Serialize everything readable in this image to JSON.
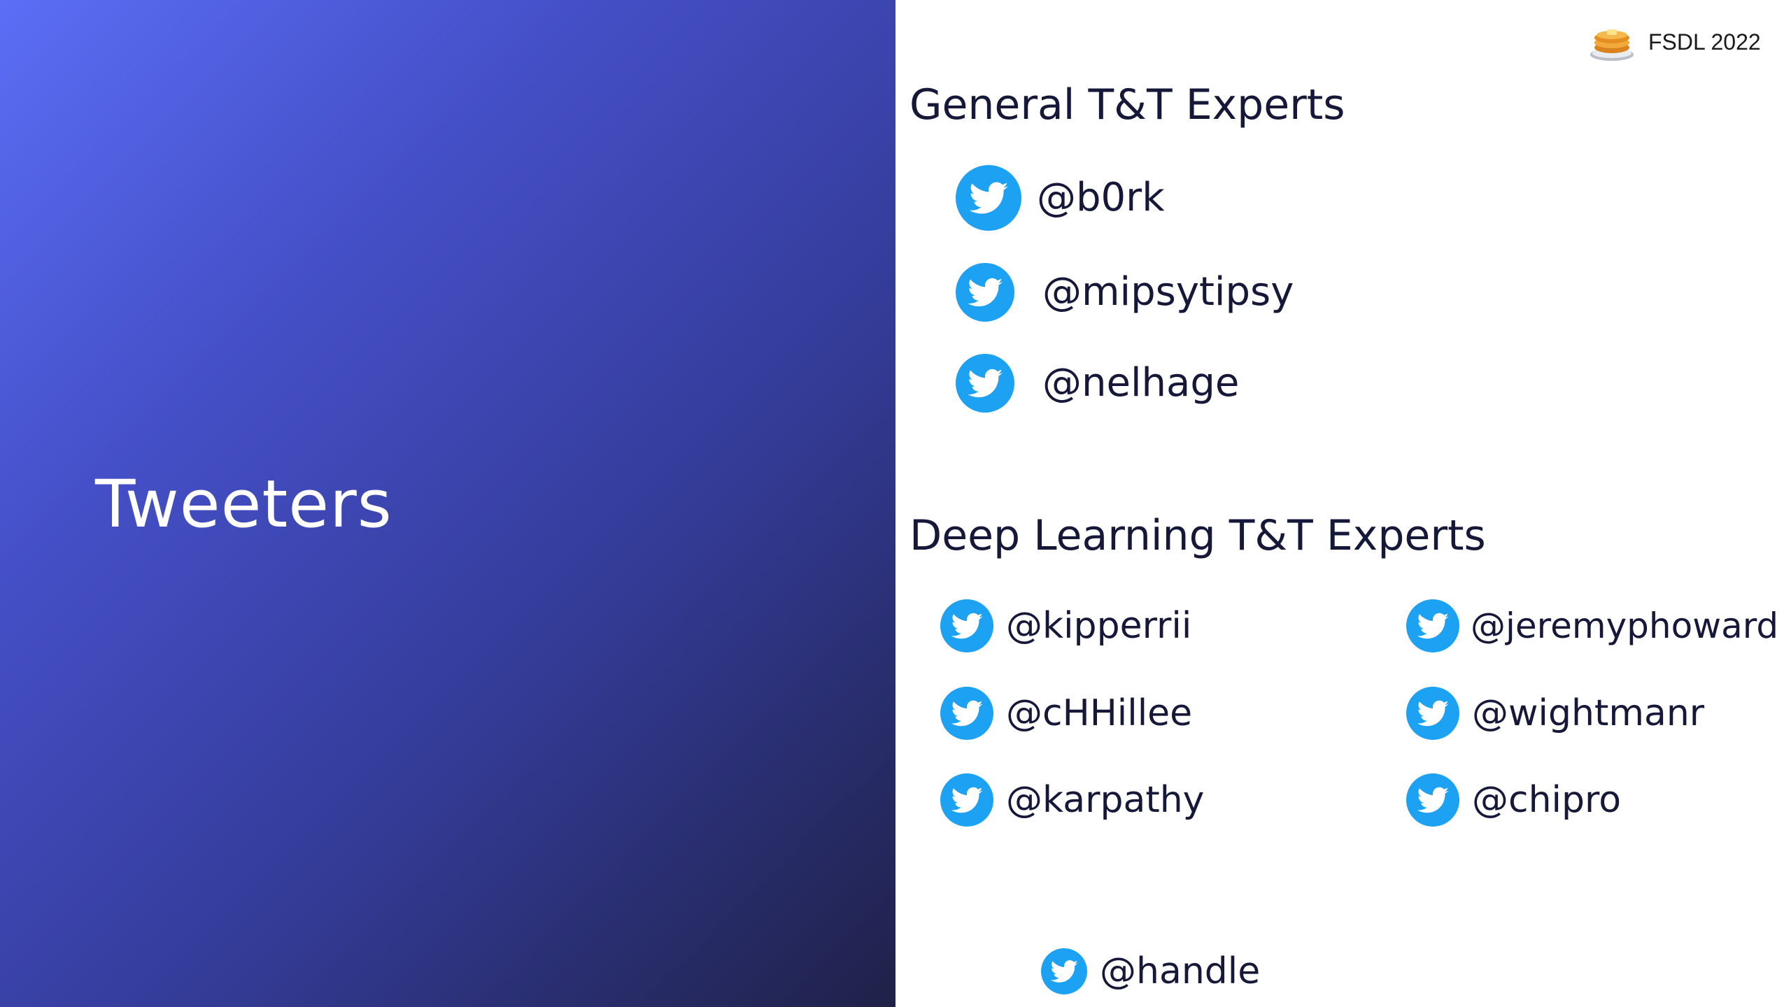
{
  "slide": {
    "title": "Tweeters",
    "brand": {
      "text": "FSDL 2022",
      "icon": "pancake-stack-icon"
    }
  },
  "colors": {
    "twitter_blue": "#1da1f2",
    "title_text": "#16183a",
    "gradient_start": "#5b6ef5",
    "gradient_end": "#1f2148"
  },
  "sections": {
    "general": {
      "title": "General T&T Experts",
      "handles": [
        "@b0rk",
        "@mipsytipsy",
        "@nelhage"
      ]
    },
    "deep_learning": {
      "title": "Deep Learning T&T Experts",
      "handles": [
        "@kipperrii",
        "@cHHillee",
        "@karpathy",
        "@jeremyphoward",
        "@wightmanr",
        "@chipro"
      ]
    }
  },
  "footer_handle": "@handle",
  "icon_name": "twitter-bird-icon"
}
